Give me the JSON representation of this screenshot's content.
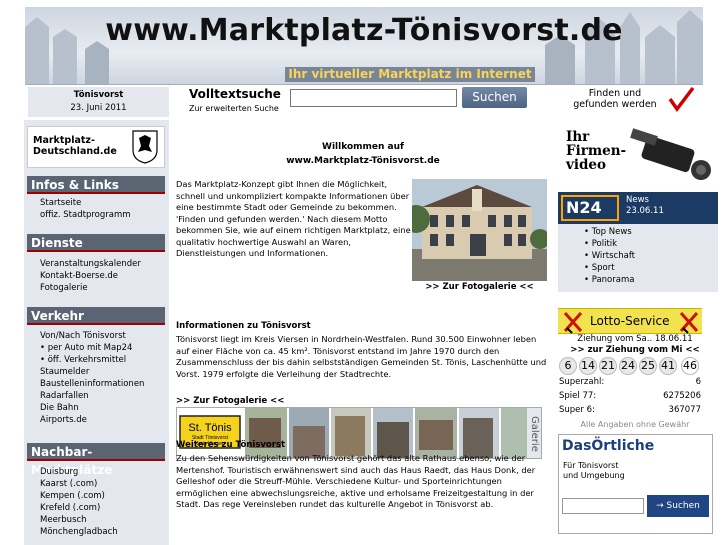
{
  "header": {
    "site_title": "www.Marktplatz-Tönisvorst.de",
    "slogan": "Ihr virtueller Marktplatz im Internet"
  },
  "location": {
    "city": "Tönisvorst",
    "date": "23. Juni 2011"
  },
  "search": {
    "title": "Volltextsuche",
    "subtitle": "Zur erweiterten Suche",
    "value": "",
    "button_label": "Suchen",
    "found_label": "Finden und gefunden werden"
  },
  "sidebar": {
    "logo_text_1": "Marktplatz-",
    "logo_text_2": "Deutschland.de",
    "sections": [
      {
        "title": "Infos & Links",
        "items": [
          "Startseite",
          "offiz. Stadtprogramm"
        ]
      },
      {
        "title": "Dienste",
        "items": [
          "Veranstaltungskalender",
          "Kontakt-Boerse.de",
          "Fotogalerie"
        ]
      },
      {
        "title": "Verkehr",
        "items": [
          "Von/Nach Tönisvorst",
          "• per Auto mit Map24",
          "• öff. Verkehrsmittel",
          "Staumelder",
          "Baustelleninformationen",
          "Radarfallen",
          "Die Bahn",
          "Airports.de"
        ]
      },
      {
        "title": "Nachbar-Marktplätze",
        "items": [
          "Duisburg",
          "Kaarst (.com)",
          "Kempen (.com)",
          "Krefeld (.com)",
          "Meerbusch",
          "Mönchengladbach"
        ]
      }
    ]
  },
  "main": {
    "welcome_line1": "Willkommen auf",
    "welcome_line2": "www.Marktplatz-Tönisvorst.de",
    "intro": "Das Marktplatz-Konzept gibt Ihnen die Möglichkeit, schnell und unkompliziert kompakte Informationen über eine bestimmte Stadt oder Gemeinde zu bekommen. 'Finden und gefunden werden.' Nach diesem Motto bekommen Sie, wie auf einem richtigen Marktplatz, eine qualitativ hochwertige Auswahl an Waren, Dienstleistungen und Informationen.",
    "photo_caption": ">> Zur Fotogalerie <<",
    "info_heading": "Informationen zu Tönisvorst",
    "info_text": "Tönisvorst liegt im Kreis Viersen in Nordrhein-Westfalen. Rund 30.500 Einwohner leben auf einer Fläche von ca. 45 km². Tönisvorst entstand im Jahre 1970 durch den Zusammenschluss der bis dahin selbstständigen Gemeinden St. Tönis, Laschenhütte und Vorst. 1979 erfolgte die Verleihung der Stadtrechte.",
    "gallery_link": ">> Zur Fotogalerie <<",
    "gallery_label": "Galerie",
    "sign_text": "St. Tönis",
    "sign_sub1": "Stadt Tönisvorst",
    "sign_sub2": "Kreis Viersen",
    "weiteres_heading": "Weiteres zu Tönisvorst",
    "weiteres_text": "Zu den Sehenswürdigkeiten von Tönisvorst gehört das alte Rathaus ebenso, wie der Mertenshof. Touristisch erwähnenswert sind auch das Haus Raedt, das Haus Donk, der Gelleshof oder die Streuff-Mühle. Verschiedene Kultur- und Sporteinrichtungen ermöglichen eine abwechslungsreiche, aktive und erholsame Freizeitgestaltung in der Stadt. Das rege Vereinsleben rundet das kulturelle Angebot in Tönisvorst ab."
  },
  "right": {
    "firmenvideo": [
      "Ihr",
      "Firmen-",
      "video"
    ],
    "n24_logo": "N24",
    "n24_label": "News",
    "n24_date": "23.06.11",
    "n24_items": [
      "• Top News",
      "• Politik",
      "• Wirtschaft",
      "• Sport",
      "• Panorama"
    ],
    "lotto_title": "Lotto-Service",
    "lotto_date": "Ziehung vom Sa.. 18.06.11",
    "lotto_link": ">> zur Ziehung vom Mi <<",
    "lotto_numbers": [
      "6",
      "14",
      "21",
      "24",
      "25",
      "41",
      "46"
    ],
    "superzahl_label": "Superzahl:",
    "superzahl_value": "6",
    "spiel77_label": "Spiel 77:",
    "spiel77_value": "6275206",
    "super6_label": "Super 6:",
    "super6_value": "367077",
    "lotto_note": "Alle Angaben ohne Gewähr",
    "oe_logo": "DasÖrtliche",
    "oe_text1": "Für Tönisvorst",
    "oe_text2": "und Umgebung",
    "oe_button": "→ Suchen"
  },
  "colors": {
    "menu_head": "#5a6473",
    "sidebar_bg": "#e4e8ee",
    "accent_red": "#9a0000",
    "lotto_yellow": "#f2e24d",
    "n24_blue": "#1c3b64"
  }
}
